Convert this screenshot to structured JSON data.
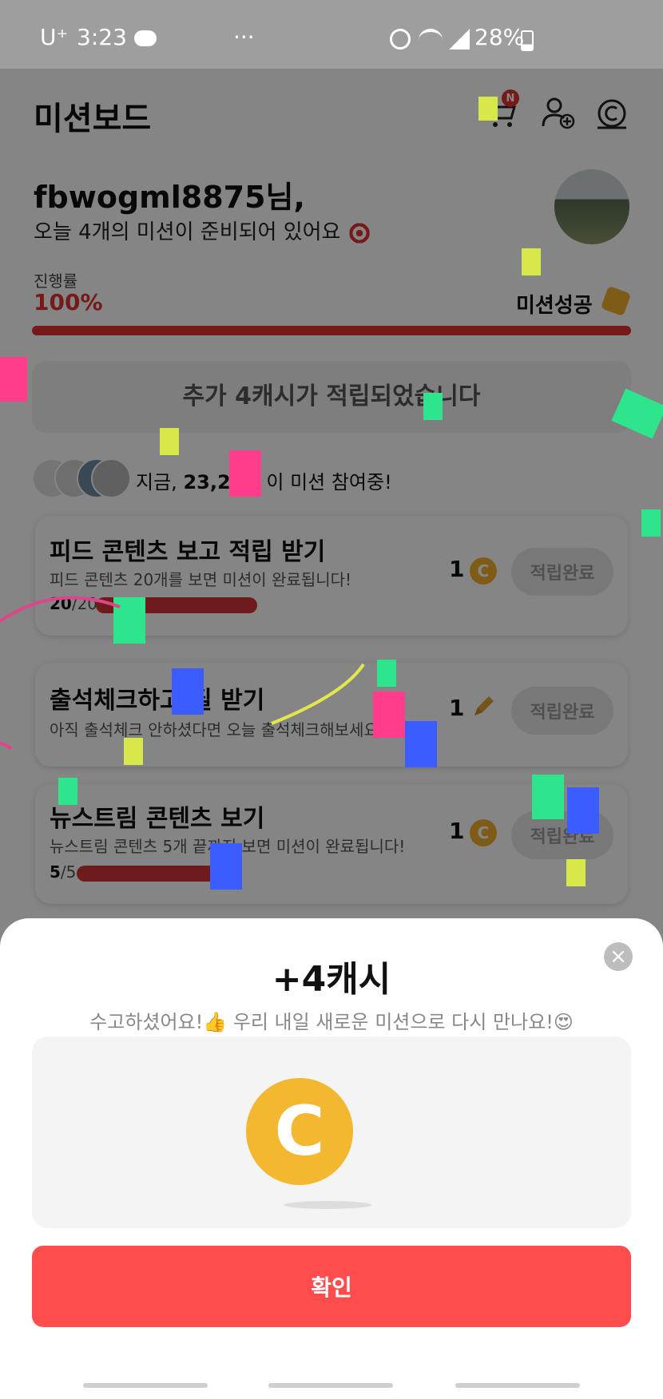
{
  "status": {
    "carrier": "U⁺",
    "time": "3:23",
    "battery": "28%"
  },
  "header": {
    "title": "미션보드",
    "cart_badge": "N"
  },
  "greeting": {
    "name": "fbwogml8875님,",
    "message": "오늘 4개의 미션이 준비되어 있어요"
  },
  "progress": {
    "label": "진행률",
    "value": "100%",
    "status": "미션성공",
    "fraction": 1.0
  },
  "banner": {
    "text": "추가 4캐시가 적립되었습니다"
  },
  "participants": {
    "prefix": "지금,",
    "count": "23,23",
    "suffix": "이 미션 참여중!"
  },
  "missions": [
    {
      "title": "피드 콘텐츠 보고 적립 받기",
      "subtitle": "피드 콘텐츠 20개를 보면 미션이 완료됩니다!",
      "progress_done": "20",
      "progress_total": "/20",
      "reward": "1",
      "reward_icon": "coin-icon",
      "button": "적립완료"
    },
    {
      "title": "출석체크하고 필 받기",
      "subtitle": "아직 출석체크 안하셨다면 오늘 출석체크해보세요!",
      "reward": "1",
      "reward_icon": "pencil-icon",
      "button": "적립완료"
    },
    {
      "title": "뉴스트림 콘텐츠 보기",
      "subtitle": "뉴스트림 콘텐츠 5개 끝까지 보면 미션이 완료됩니다!",
      "progress_done": "5",
      "progress_total": "/5",
      "reward": "1",
      "reward_icon": "coin-icon",
      "button": "적립완료"
    }
  ],
  "sheet": {
    "title": "+4캐시",
    "subtitle": "수고하셨어요!👍 우리 내일 새로운 미션으로 다시 만나요!😍",
    "coin_letter": "C",
    "confirm": "확인"
  },
  "colors": {
    "accent": "#ff4d4d",
    "coin": "#f3b730",
    "progress": "#e03030"
  }
}
